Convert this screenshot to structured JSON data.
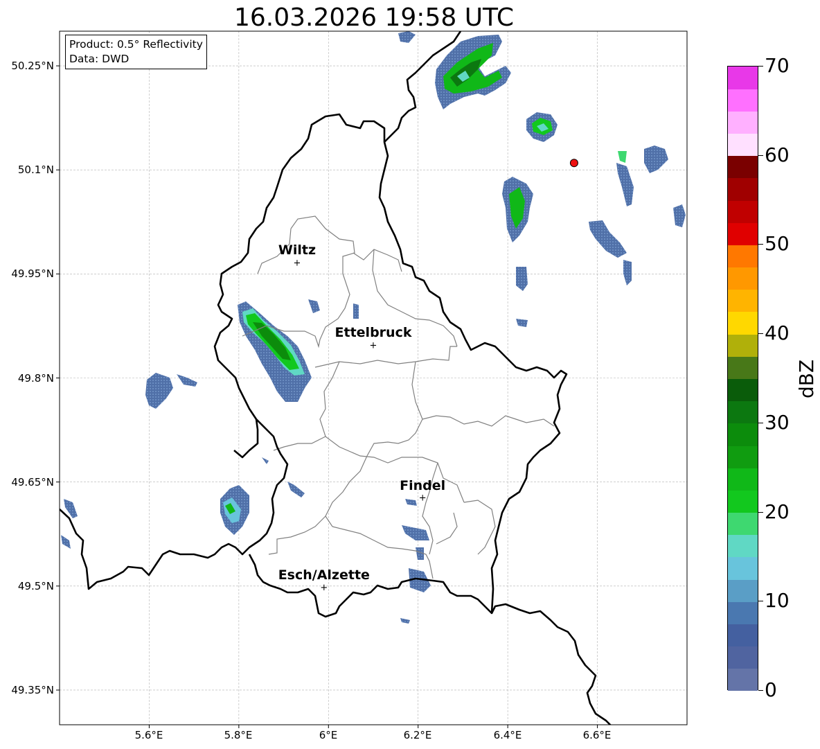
{
  "title": "16.03.2026 19:58 UTC",
  "info_box": {
    "product": "Product: 0.5° Reflectivity",
    "data": "Data: DWD"
  },
  "lat_labels": [
    "50.25°N",
    "50.1°N",
    "49.95°N",
    "49.8°N",
    "49.65°N",
    "49.5°N",
    "49.35°N"
  ],
  "lon_labels": [
    "5.6°E",
    "5.8°E",
    "6°E",
    "6.2°E",
    "6.4°E",
    "6.6°E"
  ],
  "cities": [
    {
      "name": "Wiltz",
      "lon": 5.93,
      "lat": 49.966
    },
    {
      "name": "Ettelbruck",
      "lon": 6.1,
      "lat": 49.847
    },
    {
      "name": "Findel",
      "lon": 6.21,
      "lat": 49.627
    },
    {
      "name": "Esch/Alzette",
      "lon": 5.99,
      "lat": 49.498
    }
  ],
  "radar_site": {
    "lon": 6.548,
    "lat": 50.11
  },
  "map_extent": {
    "lon_min": 5.4,
    "lon_max": 6.8,
    "lat_min": 49.3,
    "lat_max": 50.3
  },
  "colorbar": {
    "label": "dBZ",
    "ticks": [
      "0",
      "10",
      "20",
      "30",
      "40",
      "50",
      "60",
      "70"
    ],
    "min": 0,
    "max": 70,
    "step": 2.5,
    "colors": [
      "#6474a8",
      "#5064a0",
      "#4460a0",
      "#4a78b0",
      "#5a9ec6",
      "#68c4dc",
      "#60d8c4",
      "#3ed870",
      "#12c81e",
      "#10b818",
      "#109c10",
      "#0c8c0c",
      "#0c7810",
      "#0a5c0a",
      "#487818",
      "#b0b00a",
      "#ffd800",
      "#ffb400",
      "#ff9800",
      "#ff7800",
      "#e00000",
      "#c00000",
      "#a00000",
      "#7a0000",
      "#ffe0ff",
      "#ffb0ff",
      "#ff70ff",
      "#e838e8"
    ]
  },
  "colors": {
    "border": "#000000",
    "canton": "#808080",
    "grid": "#b0b0b0",
    "radar_marker": "#ee1111"
  }
}
